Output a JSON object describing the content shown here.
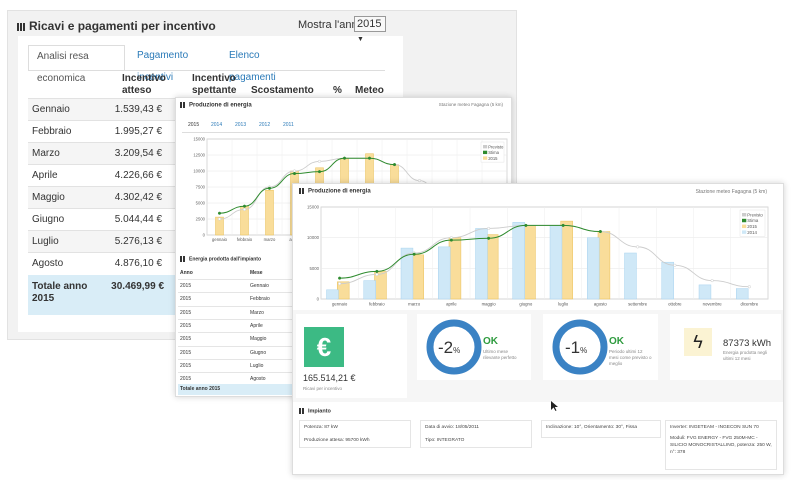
{
  "back": {
    "title": "Ricavi e pagamenti per incentivo",
    "year_label": "Mostra l'anno:",
    "year_value": "2015",
    "tabs": [
      "Analisi resa economica",
      "Pagamento incentivi",
      "Elenco pagamenti"
    ],
    "headers": {
      "expected": "Incentivo atteso",
      "due": "Incentivo spettante",
      "diff": "Scostamento",
      "pct": "%",
      "weather": "Meteo"
    },
    "rows": [
      {
        "month": "Gennaio",
        "value": "1.539,43 €"
      },
      {
        "month": "Febbraio",
        "value": "1.995,27 €"
      },
      {
        "month": "Marzo",
        "value": "3.209,54 €"
      },
      {
        "month": "Aprile",
        "value": "4.226,66 €"
      },
      {
        "month": "Maggio",
        "value": "4.302,42 €"
      },
      {
        "month": "Giugno",
        "value": "5.044,44 €"
      },
      {
        "month": "Luglio",
        "value": "5.276,13 €"
      },
      {
        "month": "Agosto",
        "value": "4.876,10 €"
      }
    ],
    "total_label": "Totale anno 2015",
    "total_value": "30.469,99 €"
  },
  "mid": {
    "title": "Produzione di energia",
    "station": "Stazione meteo Fagagna (5 km)",
    "year_tabs": [
      "2015",
      "2014",
      "2013",
      "2012",
      "2011"
    ],
    "table_title": "Energia prodotta dall'impianto",
    "col_year": "Anno",
    "col_month": "Mese",
    "rows": [
      {
        "year": "2015",
        "month": "Gennaio"
      },
      {
        "year": "2015",
        "month": "Febbraio"
      },
      {
        "year": "2015",
        "month": "Marzo"
      },
      {
        "year": "2015",
        "month": "Aprile"
      },
      {
        "year": "2015",
        "month": "Maggio"
      },
      {
        "year": "2015",
        "month": "Giugno"
      },
      {
        "year": "2015",
        "month": "Luglio"
      },
      {
        "year": "2015",
        "month": "Agosto"
      }
    ],
    "total_label": "Totale anno 2015"
  },
  "front": {
    "title": "Produzione di energia",
    "station": "Stazione meteo Fagagna (5 km)",
    "kpi1": {
      "value": "165.514,21 €",
      "caption": "Ricavi per incentivo"
    },
    "kpi2": {
      "pct": "-2",
      "unit": "%",
      "status": "OK",
      "caption": "Ultimo mese rilevante perfetto"
    },
    "kpi3": {
      "pct": "-1",
      "unit": "%",
      "status": "OK",
      "caption": "Periodo ultimi 12 mesi come previsto o meglio"
    },
    "kpi4": {
      "value": "87373 kWh",
      "caption": "Energia prodotta negli ultimi 12 mesi"
    },
    "impianto": {
      "title": "Impianto",
      "potenza": "Potenza: 87 kW",
      "produzione": "Produzione attesa: 95700 kWh",
      "avvio": "Data di avvio: 18/05/2011",
      "tipo": "Tipo: INTEGRATO",
      "inclinazione": "Inclinazione: 10°, Orientamento: 30°, Fissa",
      "inverter": "Inverter: INGETEAM - INGECON SUN 70",
      "moduli": "Moduli: FVG ENERGY - FVG 250M-MC - SILICIO MONOCRISTALLINO, potenza: 250 W, n°: 378"
    }
  },
  "colors": {
    "accent": "#2a7ab8",
    "bar_2015": "#f9dd9a",
    "bar_2014": "#cfe8f7",
    "stima": "#2e8b2e",
    "previsto": "#cccccc",
    "ring": "#3a82c4",
    "ok": "#2e9b3e",
    "euro": "#3cba84"
  },
  "chart_data": [
    {
      "type": "bar",
      "title": "Produzione di energia",
      "categories": [
        "gennaio",
        "febbraio",
        "marzo",
        "aprile",
        "maggio",
        "giugno",
        "luglio",
        "agosto",
        "settembre",
        "ottobre",
        "novembre",
        "dicembre"
      ],
      "series": [
        {
          "name": "Previsto",
          "kind": "line",
          "values": [
            2500,
            4000,
            7500,
            10000,
            11500,
            12000,
            12000,
            11000,
            8500,
            5500,
            3000,
            2000
          ]
        },
        {
          "name": "Stima",
          "kind": "line",
          "values": [
            3400,
            4500,
            7300,
            9600,
            9900,
            12000,
            12000,
            11000,
            null,
            null,
            null,
            null
          ]
        },
        {
          "name": "2015",
          "kind": "bar",
          "values": [
            2800,
            4500,
            7000,
            10000,
            10500,
            12000,
            12700,
            11000,
            null,
            null,
            null,
            null
          ]
        }
      ],
      "ylim": [
        0,
        15000
      ],
      "yticks": [
        0,
        2500,
        5000,
        7500,
        10000,
        12500,
        15000
      ],
      "legend": "top-right"
    },
    {
      "type": "bar",
      "title": "Produzione di energia",
      "categories": [
        "gennaio",
        "febbraio",
        "marzo",
        "aprile",
        "maggio",
        "giugno",
        "luglio",
        "agosto",
        "settembre",
        "ottobre",
        "novembre",
        "dicembre"
      ],
      "series": [
        {
          "name": "Previsto",
          "kind": "line",
          "values": [
            2500,
            4000,
            7500,
            10000,
            11500,
            12000,
            12000,
            11000,
            8500,
            5500,
            3000,
            2000
          ]
        },
        {
          "name": "Stima",
          "kind": "line",
          "values": [
            3400,
            4500,
            7300,
            9600,
            9900,
            12000,
            12000,
            11000,
            null,
            null,
            null,
            null
          ]
        },
        {
          "name": "2015",
          "kind": "bar",
          "values": [
            2800,
            4500,
            7200,
            10000,
            10500,
            12000,
            12700,
            11000,
            null,
            null,
            null,
            null
          ]
        },
        {
          "name": "2014",
          "kind": "bar",
          "values": [
            1500,
            3000,
            8300,
            8500,
            11500,
            12500,
            12000,
            10000,
            7500,
            6000,
            2300,
            1700
          ]
        }
      ],
      "ylim": [
        0,
        15000
      ],
      "yticks": [
        0,
        5000,
        10000,
        15000
      ],
      "legend": "top-right"
    }
  ]
}
